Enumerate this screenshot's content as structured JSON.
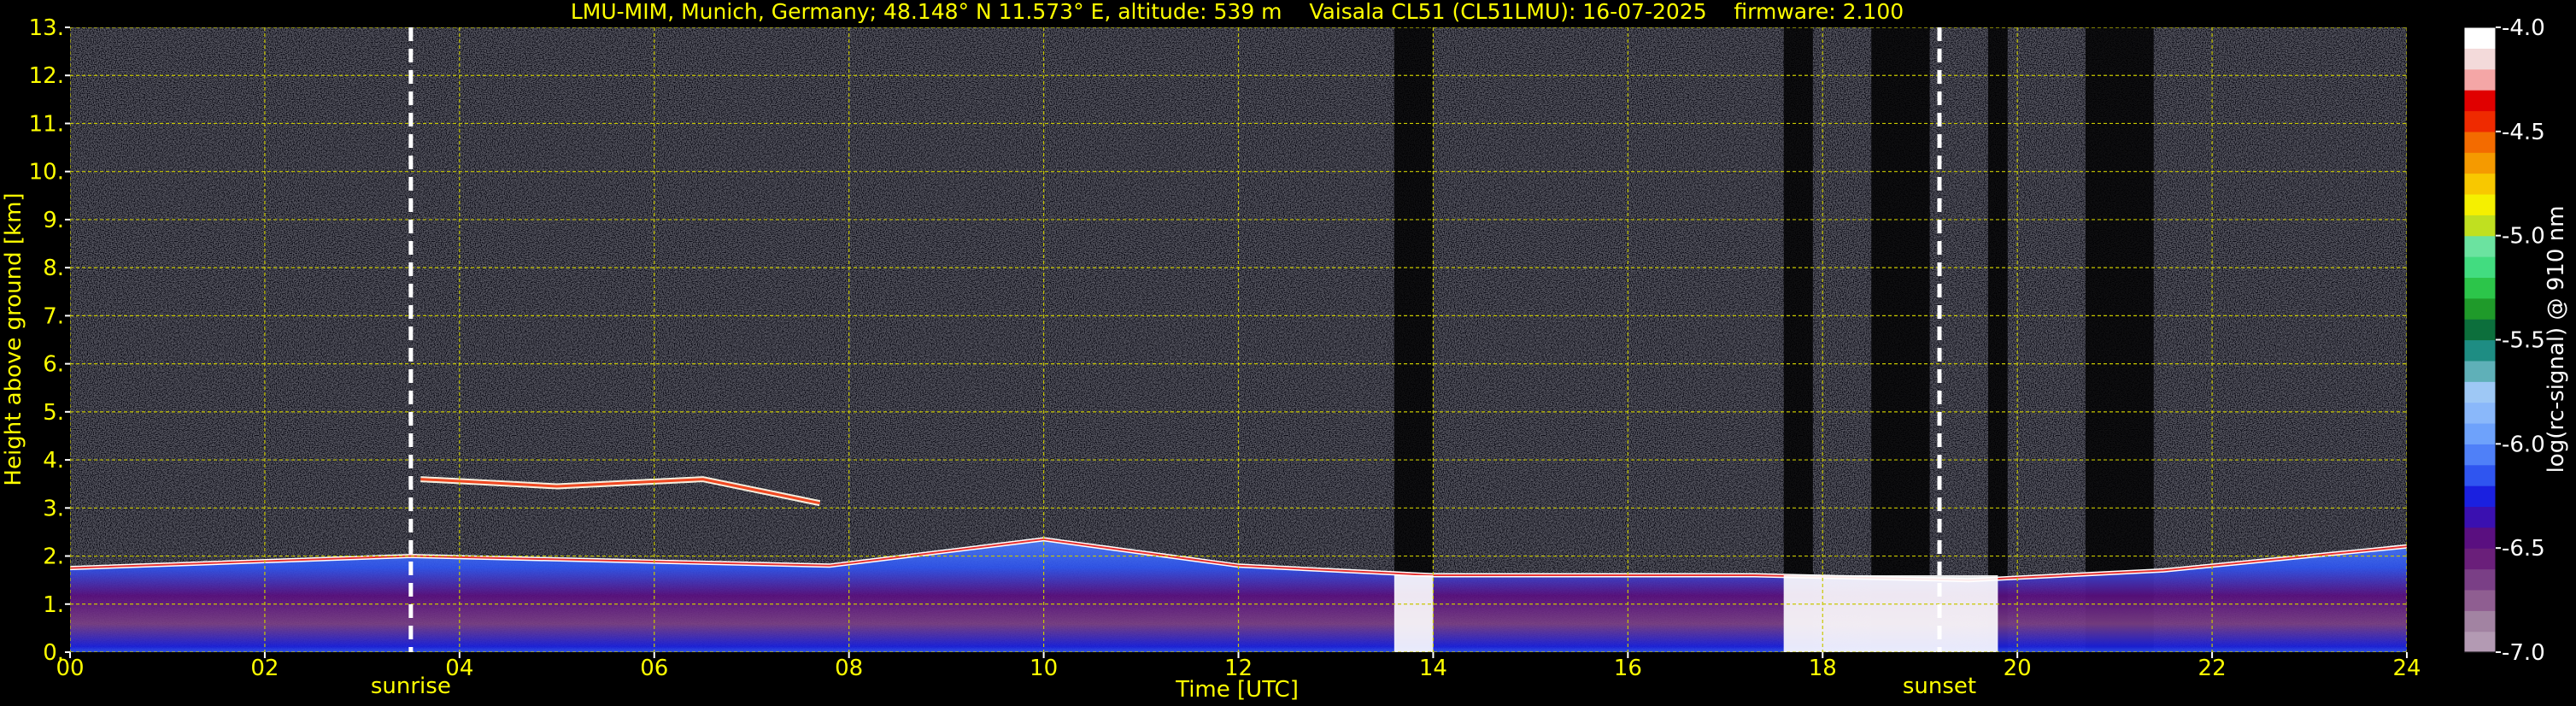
{
  "title": "LMU-MIM, Munich, Germany; 48.148° N 11.573° E, altitude: 539 m    Vaisala CL51 (CL51LMU): 16-07-2025    firmware: 2.100",
  "colors": {
    "text": "#ffff00",
    "background": "#000000",
    "grid": "#c8c800",
    "event_line": "#ffffff"
  },
  "chart_data": {
    "type": "heatmap",
    "xlabel": "Time [UTC]",
    "ylabel": "Height above ground [km]",
    "xlim": [
      0,
      24
    ],
    "ylim": [
      0,
      13
    ],
    "x_tick_labels": [
      "00",
      "02",
      "04",
      "06",
      "08",
      "10",
      "12",
      "14",
      "16",
      "18",
      "20",
      "22",
      "24"
    ],
    "x_tick_values": [
      0,
      2,
      4,
      6,
      8,
      10,
      12,
      14,
      16,
      18,
      20,
      22,
      24
    ],
    "y_tick_labels": [
      "0.",
      "1.",
      "2.",
      "3.",
      "4.",
      "5.",
      "6.",
      "7.",
      "8.",
      "9.",
      "10.",
      "11.",
      "12.",
      "13."
    ],
    "y_tick_values": [
      0,
      1,
      2,
      3,
      4,
      5,
      6,
      7,
      8,
      9,
      10,
      11,
      12,
      13
    ],
    "grid": true,
    "events": [
      {
        "label": "sunrise",
        "time": 3.5
      },
      {
        "label": "sunset",
        "time": 19.2
      }
    ],
    "colorbar": {
      "label": "log(rc-signal) @ 910 nm",
      "range": [
        -7.0,
        -4.0
      ],
      "tick_labels": [
        "-4.0",
        "-4.5",
        "-5.0",
        "-5.5",
        "-6.0",
        "-6.5",
        "-7.0"
      ],
      "tick_values": [
        -4.0,
        -4.5,
        -5.0,
        -5.5,
        -6.0,
        -6.5,
        -7.0
      ],
      "colors": [
        "#b39ab3",
        "#a283a2",
        "#8f5e91",
        "#7a3f86",
        "#6a1f7a",
        "#5a0f80",
        "#3a10b0",
        "#1a20e0",
        "#2f55f0",
        "#4f80f8",
        "#6ea2fb",
        "#8ab8fa",
        "#9ec8f5",
        "#5fb0b8",
        "#1e8d83",
        "#0c6f3c",
        "#1f9a2a",
        "#2cc54a",
        "#42dc80",
        "#6be3a0",
        "#c0e020",
        "#f5f000",
        "#f8c800",
        "#f59a00",
        "#f36b00",
        "#ef2a00",
        "#e00000",
        "#f4a6a6",
        "#f3dada",
        "#ffffff"
      ]
    },
    "features": [
      {
        "name": "boundary-layer top",
        "time": [
          0,
          3.5,
          7.8,
          10,
          12,
          14,
          17.3,
          19.5,
          21.5,
          24
        ],
        "height": [
          1.75,
          2.0,
          1.8,
          2.35,
          1.8,
          1.6,
          1.6,
          1.5,
          1.7,
          2.2
        ]
      },
      {
        "name": "elevated aerosol layer",
        "time": [
          3.6,
          5.0,
          6.5,
          7.7
        ],
        "height": [
          3.6,
          3.45,
          3.6,
          3.1
        ]
      },
      {
        "name": "low clouds / precipitation",
        "time_ranges": [
          [
            13.6,
            14.0
          ],
          [
            17.6,
            19.8
          ]
        ],
        "height": [
          0,
          1.6
        ]
      }
    ]
  }
}
